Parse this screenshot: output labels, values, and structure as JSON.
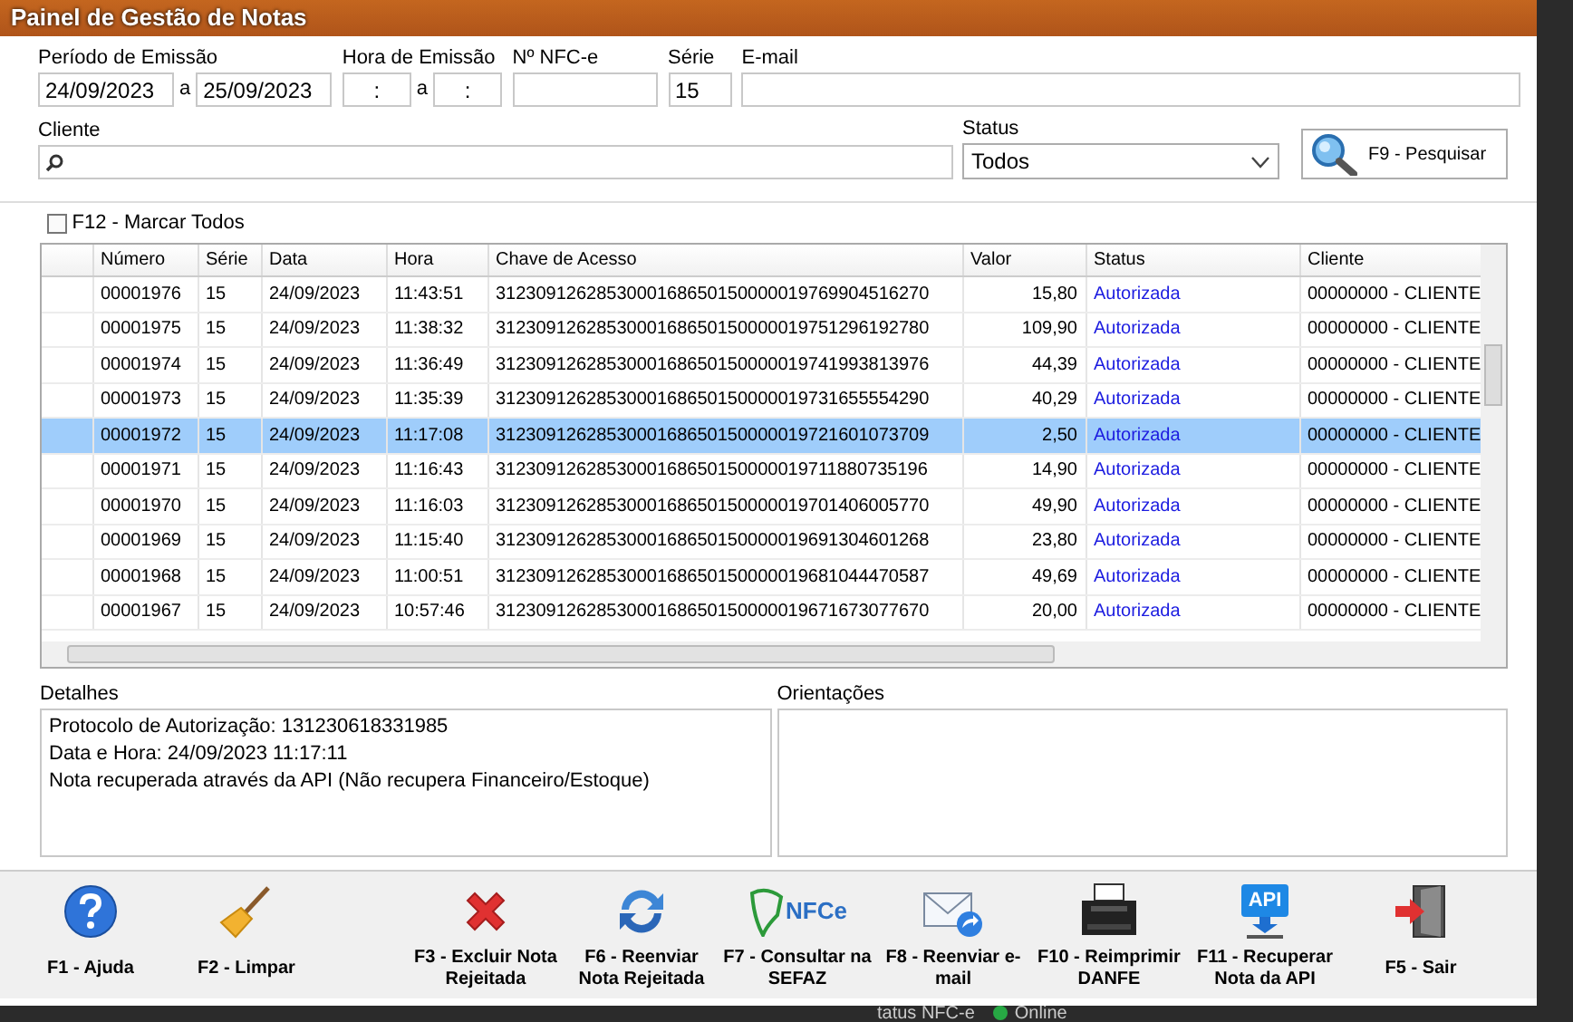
{
  "window": {
    "title": "Painel de Gestão de Notas"
  },
  "filters": [
    {
      "kind": "range",
      "label": "Período de Emissão",
      "from": "24/09/2023",
      "separator": "a",
      "to": "25/09/2023"
    },
    {
      "kind": "timerange",
      "label": "Hora de Emissão",
      "from": ":",
      "separator": "a",
      "to": ":"
    },
    {
      "kind": "text",
      "label": "Nº NFC-e"
    },
    {
      "kind": "short",
      "label": "Série",
      "value": "15"
    },
    {
      "kind": "wide",
      "label": "E-mail"
    }
  ],
  "cliente": {
    "label": "Cliente"
  },
  "status_filter": {
    "label": "Status",
    "value": "Todos"
  },
  "search_button": {
    "label": "F9 - Pesquisar"
  },
  "mark_all": {
    "label": "F12 - Marcar Todos",
    "checked": false
  },
  "table": {
    "columns": [
      "Número",
      "Série",
      "Data",
      "Hora",
      "Chave de Acesso",
      "Valor",
      "Status",
      "Cliente"
    ],
    "rows": [
      {
        "selected": false,
        "cells": [
          "00001976",
          "15",
          "24/09/2023",
          "11:43:51",
          "3123091262853000168650150000019769904516270",
          "15,80",
          "Autorizada",
          "00000000 - CLIENTE"
        ]
      },
      {
        "selected": false,
        "cells": [
          "00001975",
          "15",
          "24/09/2023",
          "11:38:32",
          "3123091262853000168650150000019751296192780",
          "109,90",
          "Autorizada",
          "00000000 - CLIENTE"
        ]
      },
      {
        "selected": false,
        "cells": [
          "00001974",
          "15",
          "24/09/2023",
          "11:36:49",
          "3123091262853000168650150000019741993813976",
          "44,39",
          "Autorizada",
          "00000000 - CLIENTE"
        ]
      },
      {
        "selected": false,
        "cells": [
          "00001973",
          "15",
          "24/09/2023",
          "11:35:39",
          "3123091262853000168650150000019731655554290",
          "40,29",
          "Autorizada",
          "00000000 - CLIENTE"
        ]
      },
      {
        "selected": true,
        "cells": [
          "00001972",
          "15",
          "24/09/2023",
          "11:17:08",
          "3123091262853000168650150000019721601073709",
          "2,50",
          "Autorizada",
          "00000000 - CLIENTE"
        ]
      },
      {
        "selected": false,
        "cells": [
          "00001971",
          "15",
          "24/09/2023",
          "11:16:43",
          "3123091262853000168650150000019711880735196",
          "14,90",
          "Autorizada",
          "00000000 - CLIENTE"
        ]
      },
      {
        "selected": false,
        "cells": [
          "00001970",
          "15",
          "24/09/2023",
          "11:16:03",
          "3123091262853000168650150000019701406005770",
          "49,90",
          "Autorizada",
          "00000000 - CLIENTE"
        ]
      },
      {
        "selected": false,
        "cells": [
          "00001969",
          "15",
          "24/09/2023",
          "11:15:40",
          "3123091262853000168650150000019691304601268",
          "23,80",
          "Autorizada",
          "00000000 - CLIENTE"
        ]
      },
      {
        "selected": false,
        "cells": [
          "00001968",
          "15",
          "24/09/2023",
          "11:00:51",
          "3123091262853000168650150000019681044470587",
          "49,69",
          "Autorizada",
          "00000000 - CLIENTE"
        ]
      },
      {
        "selected": false,
        "cells": [
          "00001967",
          "15",
          "24/09/2023",
          "10:57:46",
          "3123091262853000168650150000019671673077670",
          "20,00",
          "Autorizada",
          "00000000 - CLIENTE"
        ]
      }
    ]
  },
  "details": {
    "label": "Detalhes",
    "lines": [
      "Protocolo de Autorização: 131230618331985",
      "Data e Hora: 24/09/2023 11:17:11",
      "Nota recuperada através da API (Não recupera Financeiro/Estoque)"
    ]
  },
  "orientations": {
    "label": "Orientações"
  },
  "toolbar": [
    {
      "kind": "help",
      "label": "F1 - Ajuda"
    },
    {
      "kind": "broom",
      "label": "F2 - Limpar"
    },
    {
      "kind": "delete",
      "label": "F3 - Excluir Nota Rejeitada"
    },
    {
      "kind": "refresh",
      "label": "F6 - Reenviar Nota Rejeitada"
    },
    {
      "kind": "nfce",
      "label": "F7 - Consultar na SEFAZ",
      "icon_text": "NFCe"
    },
    {
      "kind": "mail",
      "label": "F8 - Reenviar e-mail"
    },
    {
      "kind": "printer",
      "label": "F10 - Reimprimir DANFE"
    },
    {
      "kind": "api",
      "label": "F11 - Recuperar Nota da API",
      "icon_text": "API"
    },
    {
      "kind": "exit",
      "label": "F5 - Sair"
    }
  ],
  "background": {
    "status_text": "tatus NFC-e",
    "online_text": "Online"
  }
}
